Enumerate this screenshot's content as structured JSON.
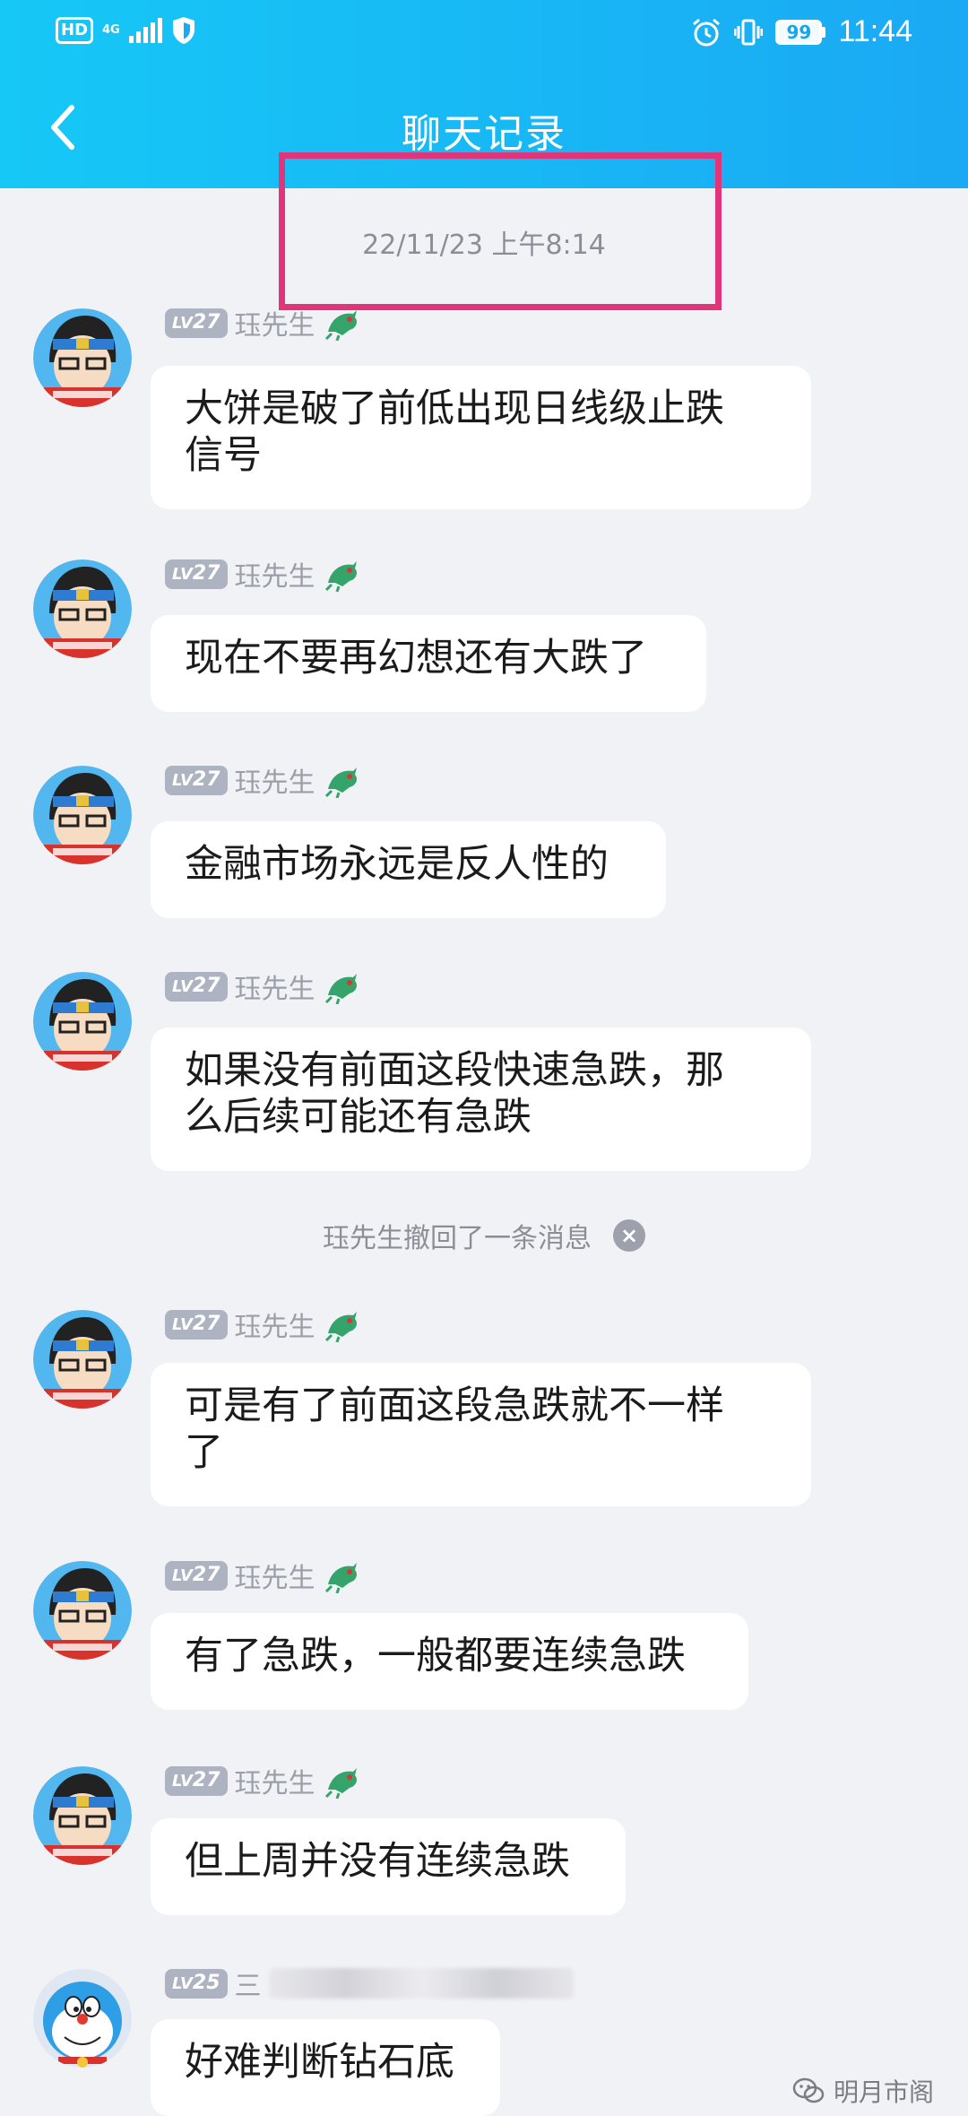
{
  "status_bar": {
    "hd": "HD",
    "network": "4G",
    "battery": "99",
    "time": "11:44"
  },
  "header": {
    "title": "聊天记录"
  },
  "timestamp": "22/11/23 上午8:14",
  "recall_notice": "珏先生撤回了一条消息",
  "messages": [
    {
      "level": "27",
      "sender": "珏先生",
      "text_lines": [
        "大饼是破了前低出现日线级止跌",
        "信号"
      ]
    },
    {
      "level": "27",
      "sender": "珏先生",
      "text_lines": [
        "现在不要再幻想还有大跌了"
      ]
    },
    {
      "level": "27",
      "sender": "珏先生",
      "text_lines": [
        "金融市场永远是反人性的"
      ]
    },
    {
      "level": "27",
      "sender": "珏先生",
      "text_lines": [
        "如果没有前面这段快速急跌，那",
        "么后续可能还有急跌"
      ]
    },
    {
      "level": "27",
      "sender": "珏先生",
      "text_lines": [
        "可是有了前面这段急跌就不一样",
        "了"
      ]
    },
    {
      "level": "27",
      "sender": "珏先生",
      "text_lines": [
        "有了急跌，一般都要连续急跌"
      ]
    },
    {
      "level": "27",
      "sender": "珏先生",
      "text_lines": [
        "但上周并没有连续急跌"
      ]
    },
    {
      "level": "25",
      "sender": "三",
      "text_lines": [
        "好难判断钻石底"
      ]
    }
  ],
  "watermark": "明月市阁",
  "colors": {
    "header": "#1aa9f4",
    "highlight": "#e0357a",
    "background": "#f1f2f6"
  }
}
